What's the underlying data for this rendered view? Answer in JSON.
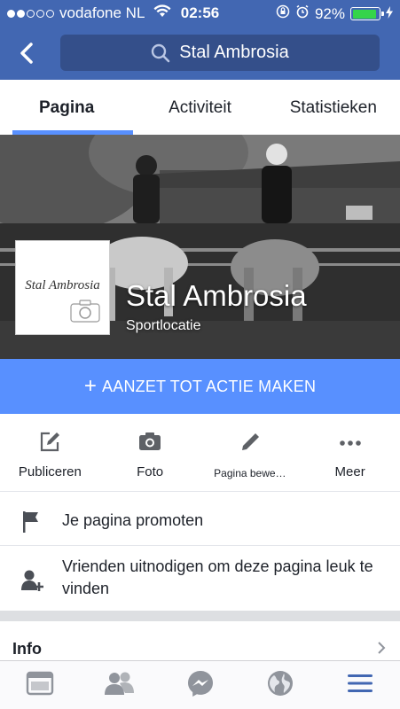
{
  "status_bar": {
    "carrier": "vodafone NL",
    "time": "02:56",
    "battery": "92%",
    "battery_level": 0.92,
    "signal_bars_filled": 2,
    "signal_bars_total": 5
  },
  "nav": {
    "back_icon": "chevron-left-icon",
    "search_icon": "search-icon",
    "search_text": "Stal Ambrosia"
  },
  "tabs": [
    {
      "label": "Pagina",
      "active": true
    },
    {
      "label": "Activiteit",
      "active": false
    },
    {
      "label": "Statistieken",
      "active": false
    }
  ],
  "profile": {
    "name": "Stal Ambrosia",
    "category": "Sportlocatie",
    "logo_text": "Stal Ambrosia",
    "camera_icon": "camera-icon"
  },
  "cta": {
    "label": "AANZET TOT ACTIE MAKEN",
    "icon": "plus-icon"
  },
  "actions": [
    {
      "label": "Publiceren",
      "icon": "compose-icon"
    },
    {
      "label": "Foto",
      "icon": "camera-icon"
    },
    {
      "label": "Pagina bewe…",
      "icon": "pencil-icon"
    },
    {
      "label": "Meer",
      "icon": "more-icon"
    }
  ],
  "list": {
    "promote": {
      "label": "Je pagina promoten",
      "icon": "flag-icon"
    },
    "invite": {
      "label": "Vrienden uitnodigen om deze pagina leuk te vinden",
      "icon": "add-friend-icon"
    }
  },
  "info": {
    "title": "Info",
    "icon": "chevron-right-icon"
  },
  "tab_bar": [
    {
      "name": "news-feed",
      "icon": "news-feed-icon"
    },
    {
      "name": "friends",
      "icon": "friends-icon"
    },
    {
      "name": "messenger",
      "icon": "messenger-icon"
    },
    {
      "name": "notifications",
      "icon": "globe-icon"
    },
    {
      "name": "menu",
      "icon": "menu-icon",
      "active": true
    }
  ],
  "colors": {
    "brand_blue": "#4267b2",
    "accent_blue": "#5890ff",
    "battery_green": "#35d44a",
    "icon_gray": "#90949c"
  }
}
